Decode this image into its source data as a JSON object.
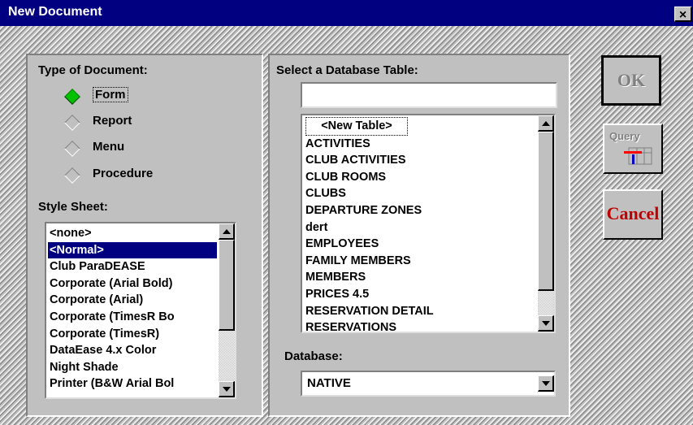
{
  "window": {
    "title": "New Document",
    "close_label": "×"
  },
  "doc_type": {
    "label": "Type of Document:",
    "options": [
      {
        "label": "Form",
        "selected": true
      },
      {
        "label": "Report",
        "selected": false
      },
      {
        "label": "Menu",
        "selected": false
      },
      {
        "label": "Procedure",
        "selected": false
      }
    ]
  },
  "style_sheet": {
    "label": "Style Sheet:",
    "items": [
      "<none>",
      "<Normal>",
      "Club ParaDEASE",
      "Corporate (Arial Bold)",
      "Corporate (Arial)",
      "Corporate (TimesR Bo",
      "Corporate (TimesR)",
      "DataEase 4.x Color",
      "Night Shade",
      "Printer (B&W Arial Bol"
    ],
    "selected_index": 1
  },
  "db_table": {
    "label": "Select a Database Table:",
    "input_value": "",
    "items": [
      "<New Table>",
      "ACTIVITIES",
      "CLUB ACTIVITIES",
      "CLUB ROOMS",
      "CLUBS",
      "DEPARTURE ZONES",
      "dert",
      "EMPLOYEES",
      "FAMILY MEMBERS",
      "MEMBERS",
      "PRICES 4.5",
      "RESERVATION DETAIL",
      "RESERVATIONS"
    ]
  },
  "database": {
    "label": "Database:",
    "value": "NATIVE"
  },
  "buttons": {
    "ok": "OK",
    "query": "Query",
    "cancel": "Cancel"
  },
  "colors": {
    "title_bar": "#000080",
    "selection": "#000080",
    "cancel_text": "#c00000",
    "radio_selected": "#00c000"
  }
}
